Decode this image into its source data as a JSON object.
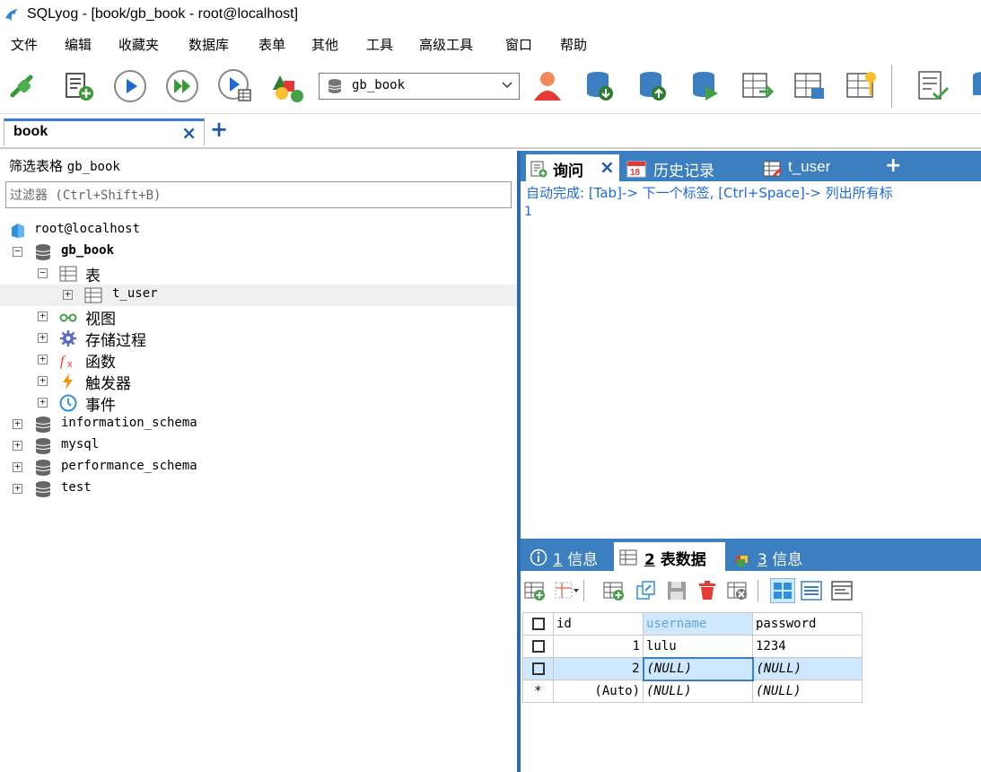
{
  "window": {
    "title": "SQLyog - [book/gb_book - root@localhost]"
  },
  "menu": [
    {
      "label": "文件",
      "underline": ""
    },
    {
      "label": "编辑",
      "underline": ""
    },
    {
      "label": "收藏夹",
      "underline": ""
    },
    {
      "label": "数据库",
      "underline": ""
    },
    {
      "label": "表单",
      "underline": ""
    },
    {
      "label": "其他",
      "underline": ""
    },
    {
      "label": "工具",
      "underline": ""
    },
    {
      "label": "高级工具",
      "underline": ""
    },
    {
      "label": "窗口",
      "underline": ""
    },
    {
      "label": "帮助",
      "underline": ""
    }
  ],
  "toolbar": {
    "database_select": "gb_book"
  },
  "connection_tab": {
    "label": "book",
    "close": "×",
    "add": "+"
  },
  "object_browser": {
    "filter_label": "筛选表格",
    "filter_db": "gb_book",
    "filter_placeholder": "过滤器 (Ctrl+Shift+B)",
    "tree": {
      "connection": "root@localhost",
      "database": "gb_book",
      "tables_folder": "表",
      "table": "t_user",
      "views": "视图",
      "procedures": "存储过程",
      "functions": "函数",
      "triggers": "触发器",
      "events": "事件",
      "other_dbs": [
        "information_schema",
        "mysql",
        "performance_schema",
        "test"
      ]
    }
  },
  "query_tabs": [
    {
      "label": "询问",
      "close": "×"
    },
    {
      "label": "历史记录"
    },
    {
      "label": "t_user"
    },
    {
      "label": "+"
    }
  ],
  "editor": {
    "hint": "自动完成: [Tab]-> 下一个标签, [Ctrl+Space]-> 列出所有标",
    "line_number": "1"
  },
  "result_tabs": [
    {
      "num": "1",
      "label": "信息"
    },
    {
      "num": "2",
      "label": "表数据"
    },
    {
      "num": "3",
      "label": "信息"
    }
  ],
  "result_grid": {
    "columns": [
      "id",
      "username",
      "password"
    ],
    "rows": [
      {
        "marker": "",
        "id": "1",
        "username": "lulu",
        "password": "1234"
      },
      {
        "marker": "",
        "id": "2",
        "username": "(NULL)",
        "password": "(NULL)"
      },
      {
        "marker": "*",
        "id": "(Auto)",
        "username": "(NULL)",
        "password": "(NULL)"
      }
    ]
  }
}
